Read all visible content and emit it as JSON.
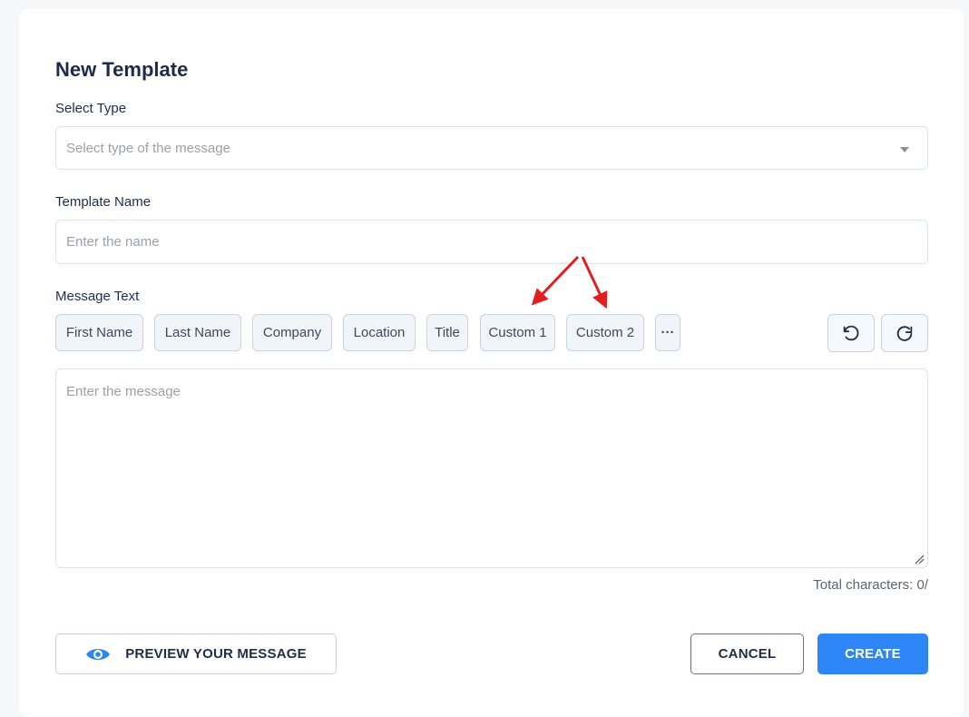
{
  "form": {
    "title": "New Template",
    "type_label": "Select Type",
    "type_placeholder": "Select type of the message",
    "name_label": "Template Name",
    "name_placeholder": "Enter the name",
    "message_label": "Message Text",
    "message_placeholder": "Enter the message",
    "counter": "Total characters: 0/"
  },
  "chips": [
    {
      "label": "First Name"
    },
    {
      "label": "Last Name"
    },
    {
      "label": "Company"
    },
    {
      "label": "Location"
    },
    {
      "label": "Title"
    },
    {
      "label": "Custom 1"
    },
    {
      "label": "Custom 2"
    },
    {
      "label": "···"
    }
  ],
  "toolbar": {
    "undo_icon": "undo-icon",
    "redo_icon": "redo-icon"
  },
  "actions": {
    "preview_label": "PREVIEW YOUR MESSAGE",
    "cancel_label": "CANCEL",
    "create_label": "CREATE"
  },
  "colors": {
    "primary": "#2e86f6",
    "arrow": "#e02020"
  }
}
